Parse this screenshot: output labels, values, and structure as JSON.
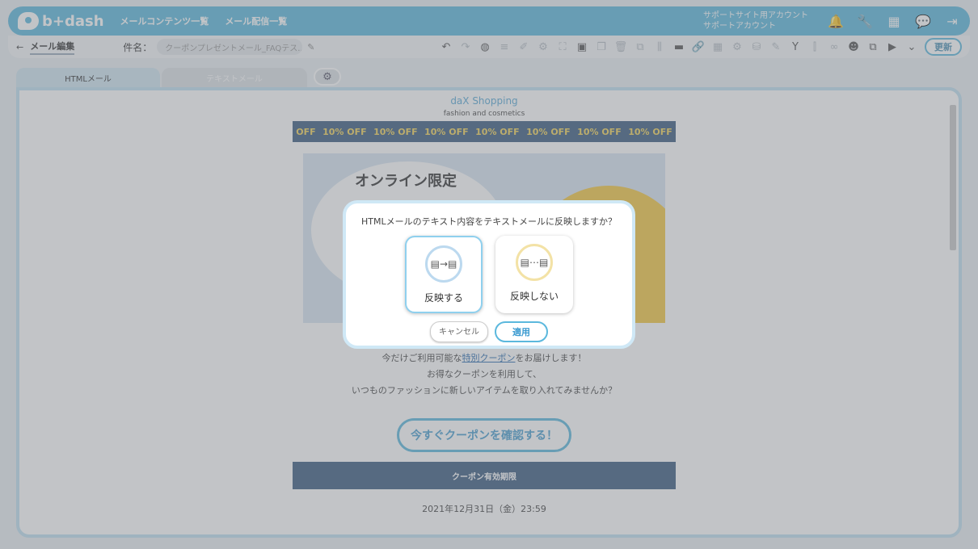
{
  "app": {
    "logo_text": "b+dash",
    "nav": [
      "メールコンテンツ一覧",
      "メール配信一覧"
    ],
    "account_line1": "サポートサイト用アカウント",
    "account_line2": "サポートアカウント"
  },
  "toolbar": {
    "back_label": "←",
    "breadcrumb": "メール編集",
    "subject_label": "件名：",
    "subject_value": "クーポンプレゼントメール_FAQテス...",
    "update_label": "更新"
  },
  "tabs": {
    "html": "HTMLメール",
    "text": "テキストメール"
  },
  "mail": {
    "shop_name": "daX Shopping",
    "tagline": "fashion and cosmetics",
    "offbar": [
      "OFF",
      "10% OFF",
      "10% OFF",
      "10% OFF",
      "10% OFF",
      "10% OFF",
      "10% OFF",
      "10% OFF"
    ],
    "hero_title": "オンライン限定",
    "body_prefix": "今だけご利用可能な",
    "body_link": "特別クーポン",
    "body_suffix": "をお届けします！",
    "body_line2": "お得なクーポンを利用して、",
    "body_line3": "いつものファッションに新しいアイテムを取り入れてみませんか？",
    "cta": "今すぐクーポンを確認する！",
    "period_heading": "クーポン有効期限",
    "date": "2021年12月31日（金）23:59"
  },
  "modal": {
    "question": "HTMLメールのテキスト内容をテキストメールに反映しますか？",
    "option_yes": "反映する",
    "option_no": "反映しない",
    "cancel": "キャンセル",
    "apply": "適用"
  },
  "colors": {
    "accent": "#5bb8dd",
    "offbar": "#3b5b80",
    "highlight": "#f3d35a"
  }
}
